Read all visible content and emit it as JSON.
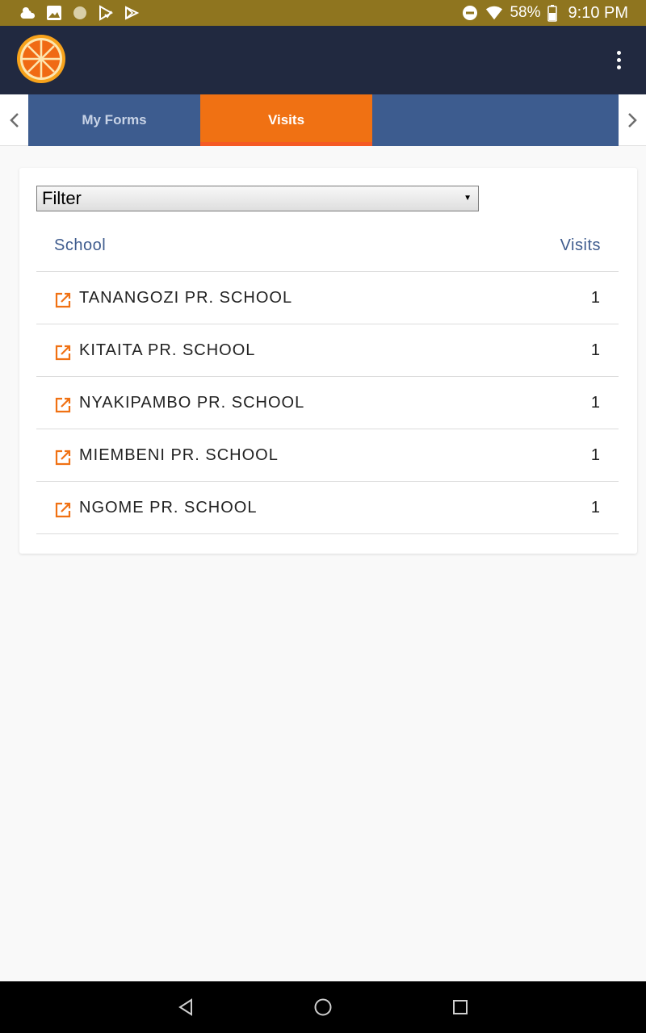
{
  "status_bar": {
    "battery": "58%",
    "time": "9:10 PM"
  },
  "tabs": [
    {
      "label": "My Forms",
      "active": false
    },
    {
      "label": "Visits",
      "active": true
    }
  ],
  "filter": {
    "selected": "Filter"
  },
  "table": {
    "headers": {
      "school": "School",
      "visits": "Visits"
    },
    "rows": [
      {
        "school": "TANANGOZI PR. SCHOOL",
        "visits": "1"
      },
      {
        "school": "KITAITA PR. SCHOOL",
        "visits": "1"
      },
      {
        "school": "NYAKIPAMBO PR. SCHOOL",
        "visits": "1"
      },
      {
        "school": "MIEMBENI PR. SCHOOL",
        "visits": "1"
      },
      {
        "school": "NGOME PR. SCHOOL",
        "visits": "1"
      }
    ]
  },
  "colors": {
    "status_bar": "#8f751f",
    "app_bar": "#212940",
    "tab_bar": "#3d5c8f",
    "tab_active": "#f07113",
    "accent": "#f07113",
    "header_text": "#3f5c8e"
  }
}
